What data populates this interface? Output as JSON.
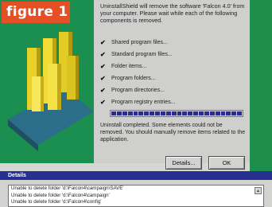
{
  "figure_label": "figure 1",
  "dialog": {
    "message": "UninstallShield will remove the software 'Falcon 4.0' from your computer. Please wait while each of the following components is removed.",
    "components": [
      "Shared program files...",
      "Standard program files...",
      "Folder items...",
      "Program folders...",
      "Program directories...",
      "Program registry entries..."
    ],
    "progress": 1.0,
    "status": "Uninstall completed. Some elements could not be removed. You should manually remove items related to the application.",
    "buttons": {
      "details": "Details...",
      "ok": "OK"
    }
  },
  "details": {
    "title": "Details",
    "lines": [
      "Unable to delete folder 'd:\\Falcon4\\campaign\\SAVE'",
      "Unable to delete folder 'd:\\Falcon4\\campaign'",
      "Unable to delete folder 'd:\\Falcon4\\config'"
    ]
  },
  "colors": {
    "green": "#1b8f4f",
    "orange": "#e44f25",
    "navy": "#25308f",
    "progress": "#2b2c8e"
  },
  "icons": [
    "check-icon",
    "scroll-up-icon",
    "installer-art-graphic"
  ]
}
